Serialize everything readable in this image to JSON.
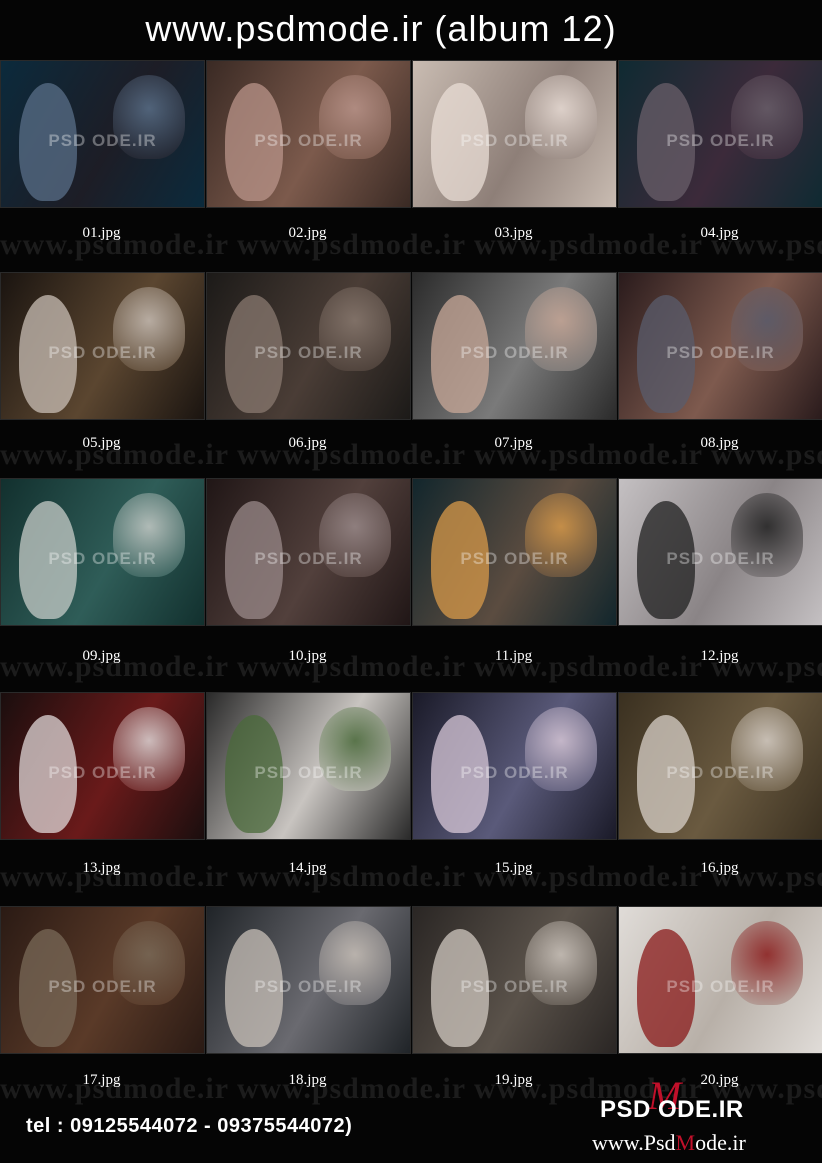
{
  "header": {
    "title": "www.psdmode.ir (album 12)"
  },
  "watermark": {
    "bg_text": "www.psdmode.ir",
    "thumb_text": "PSD ODE.IR"
  },
  "thumbnails": [
    {
      "label": "01.jpg",
      "colors": [
        "#0b2a3c",
        "#1d1d26",
        "#5a6f88"
      ]
    },
    {
      "label": "02.jpg",
      "colors": [
        "#3a2a24",
        "#7c5a4c",
        "#b9948a"
      ]
    },
    {
      "label": "03.jpg",
      "colors": [
        "#c9bcb2",
        "#8e7f78",
        "#e9ddd6"
      ]
    },
    {
      "label": "04.jpg",
      "colors": [
        "#0f2a32",
        "#3c2a3a",
        "#6a5f6a"
      ]
    },
    {
      "label": "05.jpg",
      "colors": [
        "#1a1410",
        "#5b4630",
        "#c9bfb6"
      ]
    },
    {
      "label": "06.jpg",
      "colors": [
        "#1c1a18",
        "#4a3d36",
        "#8a7a70"
      ]
    },
    {
      "label": "07.jpg",
      "colors": [
        "#2b2b2b",
        "#7a7a7a",
        "#c8a898"
      ]
    },
    {
      "label": "08.jpg",
      "colors": [
        "#2a1b1c",
        "#7e5a4e",
        "#5a5c6c"
      ]
    },
    {
      "label": "09.jpg",
      "colors": [
        "#12302e",
        "#2f5d58",
        "#c7ccc8"
      ]
    },
    {
      "label": "10.jpg",
      "colors": [
        "#201616",
        "#52403c",
        "#9a8a8a"
      ]
    },
    {
      "label": "11.jpg",
      "colors": [
        "#12262c",
        "#5b4c40",
        "#d89a4a"
      ]
    },
    {
      "label": "12.jpg",
      "colors": [
        "#c4c0c2",
        "#8a8486",
        "#202020"
      ]
    },
    {
      "label": "13.jpg",
      "colors": [
        "#1a0e0e",
        "#6a1a1a",
        "#e0d8d8"
      ]
    },
    {
      "label": "14.jpg",
      "colors": [
        "#2a2a2a",
        "#c8c4c0",
        "#4a6a3a"
      ]
    },
    {
      "label": "15.jpg",
      "colors": [
        "#1a1a28",
        "#5a5a7a",
        "#d8c8d8"
      ]
    },
    {
      "label": "16.jpg",
      "colors": [
        "#3a3020",
        "#6a5a40",
        "#d8d0c8"
      ]
    },
    {
      "label": "17.jpg",
      "colors": [
        "#2a1a14",
        "#5a3a28",
        "#7a6a58"
      ]
    },
    {
      "label": "18.jpg",
      "colors": [
        "#202428",
        "#6a6a70",
        "#c8c0b8"
      ]
    },
    {
      "label": "19.jpg",
      "colors": [
        "#2a2624",
        "#5a524a",
        "#d0c8c0"
      ]
    },
    {
      "label": "20.jpg",
      "colors": [
        "#e0dcd8",
        "#b8b0a8",
        "#8a1a1a"
      ]
    }
  ],
  "footer": {
    "tel": "tel : 09125544072 - 09375544072)",
    "logo_text": "PSD ODE.IR",
    "logo_accent": "M",
    "site_prefix": "www.Psd",
    "site_accent": "M",
    "site_suffix": "ode.ir"
  }
}
